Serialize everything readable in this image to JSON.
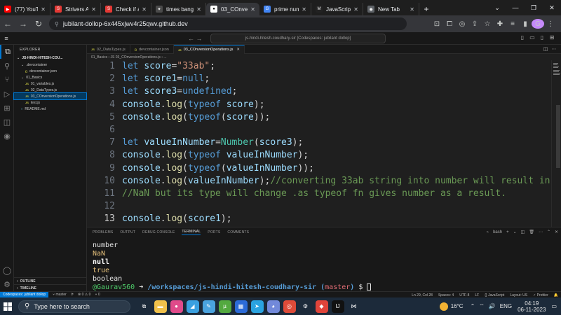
{
  "browser": {
    "tabs": [
      {
        "label": "(77) YouTu",
        "fav_color": "#ff0000",
        "fav_glyph": "▶"
      },
      {
        "label": "Strivers A2",
        "fav_color": "#e53935",
        "fav_glyph": "S"
      },
      {
        "label": "Check if a",
        "fav_color": "#e53935",
        "fav_glyph": "S"
      },
      {
        "label": "times bang",
        "fav_color": "#4a4a4a",
        "fav_glyph": "✦"
      },
      {
        "label": "03_COnver",
        "fav_color": "#ffffff",
        "fav_glyph": "●",
        "active": true
      },
      {
        "label": "prime num",
        "fav_color": "#4285f4",
        "fav_glyph": "G"
      },
      {
        "label": "JavaScript",
        "fav_color": "#222222",
        "fav_glyph": "M"
      },
      {
        "label": "New Tab",
        "fav_color": "#5f6368",
        "fav_glyph": "◉"
      }
    ],
    "url": "jubilant-dollop-6x445xjwv4r25qwv.github.dev",
    "profile_initial": "G"
  },
  "vscode": {
    "command_center": "js-hindi-hitesh-coudhary-sir [Codespaces: jubilant dollop]",
    "explorer_title": "EXPLORER",
    "workspace": "JS-HINDI-HITESH-COU...",
    "tree": [
      {
        "label": ".devcontainer",
        "kind": "folder",
        "indent": 1
      },
      {
        "label": "devcontainer.json",
        "kind": "json",
        "indent": 2
      },
      {
        "label": "01_Basics",
        "kind": "folder",
        "indent": 1
      },
      {
        "label": "01_variables.js",
        "kind": "js",
        "indent": 2
      },
      {
        "label": "02_DataTypes.js",
        "kind": "js",
        "indent": 2
      },
      {
        "label": "03_COnversionOperations.js",
        "kind": "js",
        "indent": 2,
        "selected": true
      },
      {
        "label": "test.js",
        "kind": "js",
        "indent": 2
      },
      {
        "label": "README.md",
        "kind": "md",
        "indent": 1
      }
    ],
    "outline_label": "OUTLINE",
    "timeline_label": "TIMELINE",
    "editor_tabs": [
      {
        "label": "02_DataTypes.js",
        "kind": "js"
      },
      {
        "label": "devcontainer.json",
        "kind": "json"
      },
      {
        "label": "03_COnversionOperations.js",
        "kind": "js",
        "active": true
      }
    ],
    "breadcrumb": "01_Basics  ›  JS 03_COnversionOperations.js  ›  ...",
    "code_lines": [
      {
        "n": "1",
        "tokens": [
          [
            "let",
            "k-let"
          ],
          [
            " ",
            ""
          ],
          [
            "score",
            "k-var"
          ],
          [
            "=",
            "k-op"
          ],
          [
            "\"33ab\"",
            "k-str"
          ],
          [
            ";",
            "k-pn"
          ]
        ]
      },
      {
        "n": "2",
        "tokens": [
          [
            "let",
            "k-let"
          ],
          [
            " ",
            ""
          ],
          [
            "score1",
            "k-var"
          ],
          [
            "=",
            "k-op"
          ],
          [
            "null",
            "k-blu"
          ],
          [
            ";",
            "k-pn"
          ]
        ]
      },
      {
        "n": "3",
        "tokens": [
          [
            "let",
            "k-let"
          ],
          [
            " ",
            ""
          ],
          [
            "score3",
            "k-var"
          ],
          [
            "=",
            "k-op"
          ],
          [
            "undefined",
            "k-blu"
          ],
          [
            ";",
            "k-pn"
          ]
        ]
      },
      {
        "n": "4",
        "tokens": [
          [
            "console",
            "k-var"
          ],
          [
            ".",
            "k-pn"
          ],
          [
            "log",
            "k-fn"
          ],
          [
            "(",
            "k-pn"
          ],
          [
            "typeof",
            "k-kw"
          ],
          [
            " ",
            ""
          ],
          [
            "score",
            "k-var"
          ],
          [
            ");",
            "k-pn"
          ]
        ]
      },
      {
        "n": "5",
        "tokens": [
          [
            "console",
            "k-var"
          ],
          [
            ".",
            "k-pn"
          ],
          [
            "log",
            "k-fn"
          ],
          [
            "(",
            "k-pn"
          ],
          [
            "typeof",
            "k-kw"
          ],
          [
            "(",
            "k-pn"
          ],
          [
            "score",
            "k-var"
          ],
          [
            "));",
            "k-pn"
          ]
        ]
      },
      {
        "n": "6",
        "tokens": []
      },
      {
        "n": "7",
        "tokens": [
          [
            "let",
            "k-let"
          ],
          [
            " ",
            ""
          ],
          [
            "valueInNumber",
            "k-var"
          ],
          [
            "=",
            "k-op"
          ],
          [
            "Number",
            "k-obj"
          ],
          [
            "(",
            "k-pn"
          ],
          [
            "score3",
            "k-var"
          ],
          [
            ");",
            "k-pn"
          ]
        ]
      },
      {
        "n": "8",
        "tokens": [
          [
            "console",
            "k-var"
          ],
          [
            ".",
            "k-pn"
          ],
          [
            "log",
            "k-fn"
          ],
          [
            "(",
            "k-pn"
          ],
          [
            "typeof",
            "k-kw"
          ],
          [
            " ",
            ""
          ],
          [
            "valueInNumber",
            "k-var"
          ],
          [
            ");",
            "k-pn"
          ]
        ]
      },
      {
        "n": "9",
        "tokens": [
          [
            "console",
            "k-var"
          ],
          [
            ".",
            "k-pn"
          ],
          [
            "log",
            "k-fn"
          ],
          [
            "(",
            "k-pn"
          ],
          [
            "typeof",
            "k-kw"
          ],
          [
            "(",
            "k-pn"
          ],
          [
            "valueInNumber",
            "k-var"
          ],
          [
            "));",
            "k-pn"
          ]
        ]
      },
      {
        "n": "10",
        "tokens": [
          [
            "console",
            "k-var"
          ],
          [
            ".",
            "k-pn"
          ],
          [
            "log",
            "k-fn"
          ],
          [
            "(",
            "k-pn"
          ],
          [
            "valueInNumber",
            "k-var"
          ],
          [
            ");",
            "k-pn"
          ],
          [
            "//converting 33ab string into number will result in",
            "k-cm"
          ]
        ]
      },
      {
        "n": "11",
        "tokens": [
          [
            "//NaN but its type will change .as typeof fn gives number as a result.",
            "k-cm"
          ]
        ]
      },
      {
        "n": "12",
        "tokens": []
      },
      {
        "n": "13",
        "tokens": [
          [
            "console",
            "k-var"
          ],
          [
            ".",
            "k-pn"
          ],
          [
            "log",
            "k-fn"
          ],
          [
            "(",
            "k-pn"
          ],
          [
            "score1",
            "k-var"
          ],
          [
            ");",
            "k-pn"
          ]
        ]
      }
    ],
    "panel_tabs": [
      "PROBLEMS",
      "OUTPUT",
      "DEBUG CONSOLE",
      "TERMINAL",
      "PORTS",
      "COMMENTS"
    ],
    "active_panel_tab": "TERMINAL",
    "terminal_shell": "bash",
    "terminal_lines": [
      {
        "text": "number",
        "cls": "t-white"
      },
      {
        "text": "NaN",
        "cls": "t-yel"
      },
      {
        "text": "null",
        "cls": "t-bold"
      },
      {
        "text": "true",
        "cls": "t-yel"
      },
      {
        "text": "boolean",
        "cls": "t-white"
      }
    ],
    "prompt": {
      "user": "@Gaurav560",
      "arrow": " ➜ ",
      "path": "/workspaces/js-hindi-hitesh-coudhary-sir",
      "branch_open": " (",
      "branch": "master",
      "branch_close": ")",
      "symbol": " $ "
    },
    "status": {
      "remote": "Codespaces: jubilant dollop",
      "branch": "master",
      "sync": "⟳",
      "problems": "⊗ 0 ⚠ 0",
      "ports": "⑂ 0",
      "cursor_pos": "Ln 29, Col 28",
      "spaces": "Spaces: 4",
      "encoding": "UTF-8",
      "eol": "LF",
      "language": "{} JavaScript",
      "layout": "Layout: US",
      "prettier": "✓ Prettier"
    }
  },
  "taskbar": {
    "search_placeholder": "Type here to search",
    "apps": [
      {
        "name": "taskview-icon",
        "color": "#1c2a3a",
        "glyph": "⧉"
      },
      {
        "name": "file-explorer-icon",
        "color": "#f0c14b",
        "glyph": "▬"
      },
      {
        "name": "chrome-profile-icon",
        "color": "#e04a8a",
        "glyph": "●"
      },
      {
        "name": "photos-icon",
        "color": "#3aa0e0",
        "glyph": "◢"
      },
      {
        "name": "notepad-icon",
        "color": "#4aa3df",
        "glyph": "✎"
      },
      {
        "name": "utorrent-icon",
        "color": "#53a93f",
        "glyph": "µ"
      },
      {
        "name": "store-icon",
        "color": "#2c6bd8",
        "glyph": "▦"
      },
      {
        "name": "telegram-icon",
        "color": "#2aa3e0",
        "glyph": "➤"
      },
      {
        "name": "discord-icon",
        "color": "#7289da",
        "glyph": "◕"
      },
      {
        "name": "chrome-icon",
        "color": "#dd4b39",
        "glyph": "◎"
      },
      {
        "name": "settings-icon",
        "color": "#1c2a3a",
        "glyph": "⚙"
      },
      {
        "name": "anydesk-icon",
        "color": "#e0443a",
        "glyph": "◆"
      },
      {
        "name": "intellij-icon",
        "color": "#111111",
        "glyph": "IJ"
      },
      {
        "name": "vscode-icon",
        "color": "#1c2a3a",
        "glyph": "⋈"
      }
    ],
    "temperature": "16°C",
    "language": "ENG",
    "time": "04:19",
    "date": "06-11-2023"
  }
}
